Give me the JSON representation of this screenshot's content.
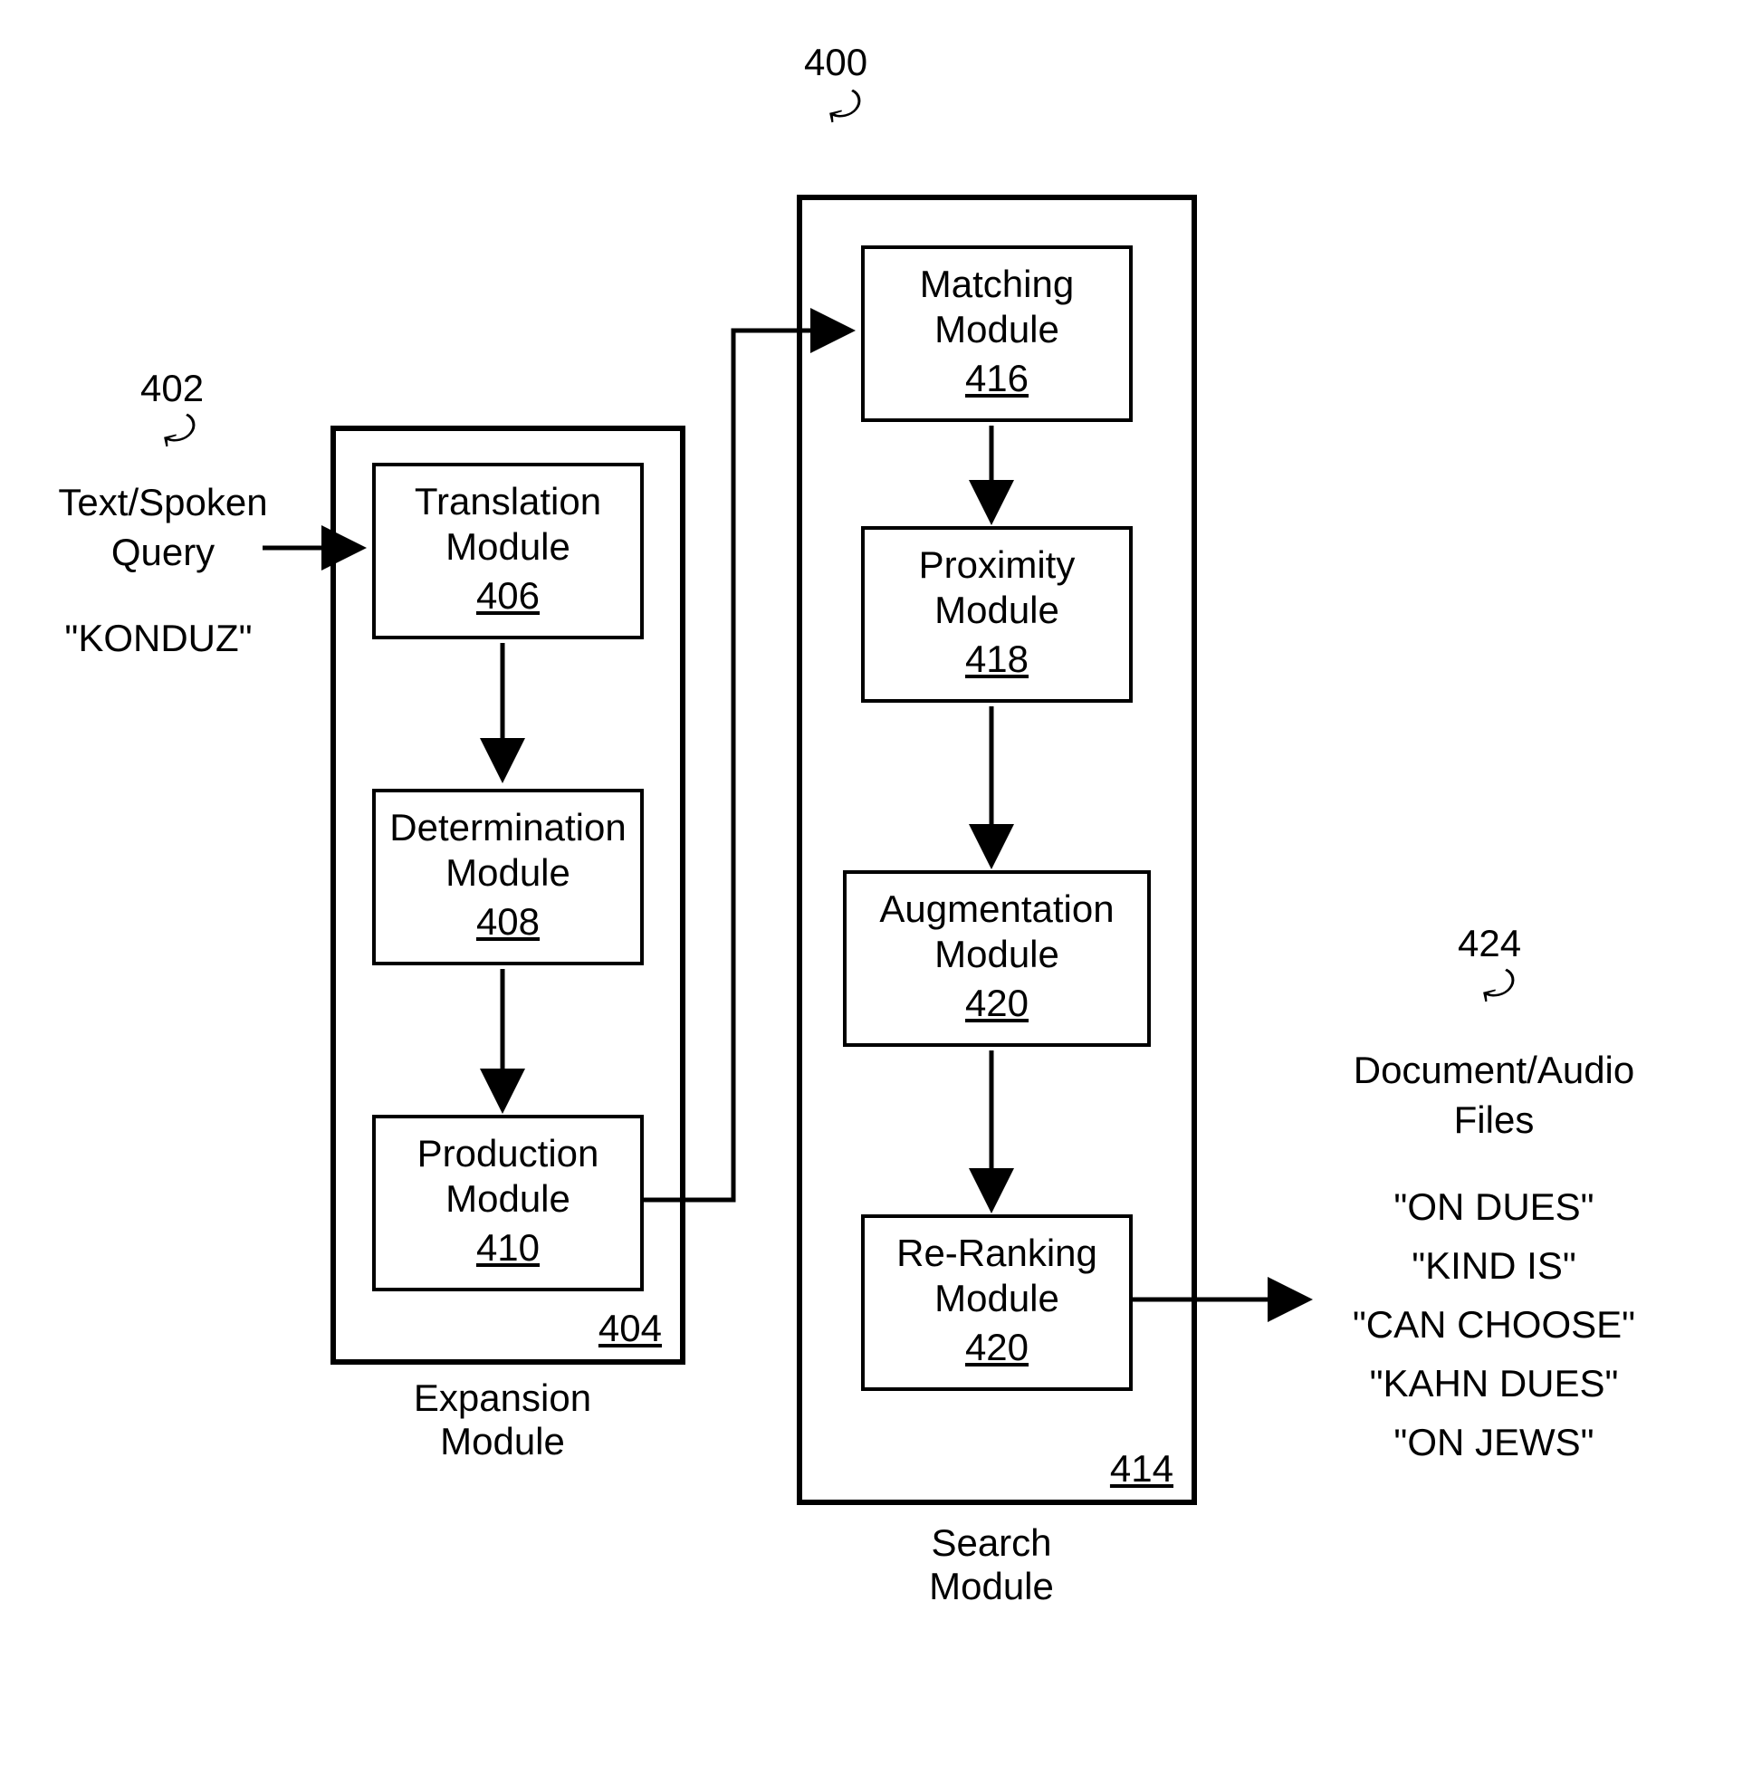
{
  "figure_ref": "400",
  "input": {
    "ref": "402",
    "label_line1": "Text/Spoken",
    "label_line2": "Query",
    "example": "\"KONDUZ\""
  },
  "expansion": {
    "caption_line1": "Expansion",
    "caption_line2": "Module",
    "ref": "404",
    "modules": {
      "translation": {
        "title_l1": "Translation",
        "title_l2": "Module",
        "ref": "406"
      },
      "determination": {
        "title_l1": "Determination",
        "title_l2": "Module",
        "ref": "408"
      },
      "production": {
        "title_l1": "Production",
        "title_l2": "Module",
        "ref": "410"
      }
    }
  },
  "search": {
    "caption_line1": "Search",
    "caption_line2": "Module",
    "ref": "414",
    "modules": {
      "matching": {
        "title_l1": "Matching",
        "title_l2": "Module",
        "ref": "416"
      },
      "proximity": {
        "title_l1": "Proximity",
        "title_l2": "Module",
        "ref": "418"
      },
      "augmentation": {
        "title_l1": "Augmentation",
        "title_l2": "Module",
        "ref": "420"
      },
      "reranking": {
        "title_l1": "Re-Ranking",
        "title_l2": "Module",
        "ref": "420"
      }
    }
  },
  "output": {
    "ref": "424",
    "label_line1": "Document/Audio",
    "label_line2": "Files",
    "results": [
      "\"ON DUES\"",
      "\"KIND IS\"",
      "\"CAN CHOOSE\"",
      "\"KAHN DUES\"",
      "\"ON JEWS\""
    ]
  }
}
